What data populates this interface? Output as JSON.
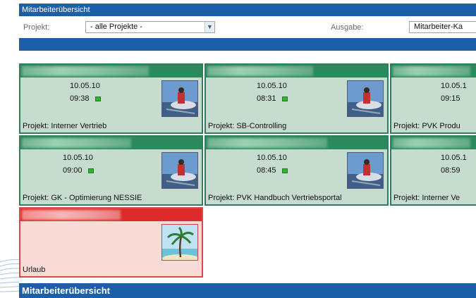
{
  "window": {
    "title": "Mitarbeiterübersicht"
  },
  "filter": {
    "project_label": "Projekt:",
    "project_value": "- alle Projekte -",
    "output_label": "Ausgabe:",
    "output_value": "Mitarbeiter-Ka"
  },
  "cards": [
    {
      "date": "10.05.10",
      "time": "09:38",
      "project": "Projekt: Interner Vertrieb",
      "status": "green"
    },
    {
      "date": "10.05.10",
      "time": "08:31",
      "project": "Projekt: SB-Controlling",
      "status": "green"
    },
    {
      "date": "10.05.1",
      "time": "09:15",
      "project": "Projekt: PVK Produ",
      "status": "none"
    },
    {
      "date": "10.05.10",
      "time": "09:00",
      "project": "Projekt: GK - Optimierung NESSIE",
      "status": "green"
    },
    {
      "date": "10.05.10",
      "time": "08:45",
      "project": "Projekt: PVK Handbuch Vertriebsportal",
      "status": "green"
    },
    {
      "date": "10.05.1",
      "time": "08:59",
      "project": "Projekt: Interner Ve",
      "status": "none"
    },
    {
      "date": "",
      "time": "",
      "project": "Urlaub",
      "status": "vacation"
    }
  ],
  "footer": {
    "title": "Mitarbeiterübersicht"
  },
  "colors": {
    "header_blue": "#1a5fa8",
    "card_green": "#2a8a5d",
    "card_bg": "#c6dccf",
    "vacation_red": "#dd2b2b",
    "vacation_bg": "#f8dad6",
    "status_green": "#2fb42f"
  }
}
